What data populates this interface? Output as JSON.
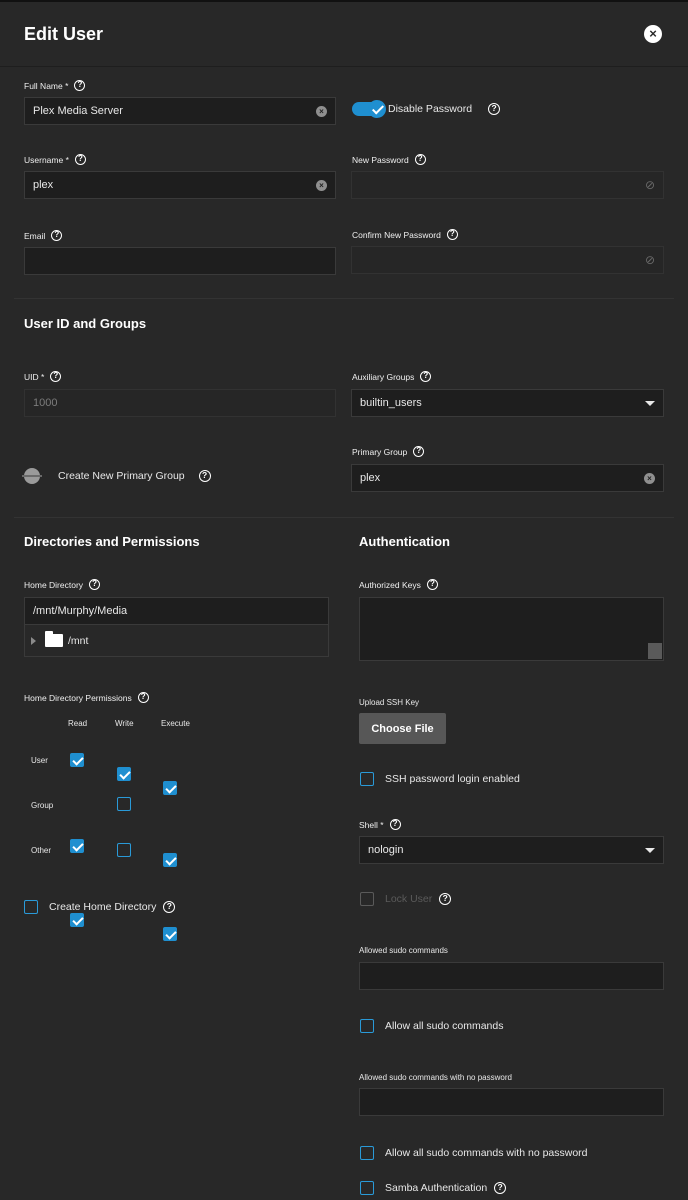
{
  "header": {
    "title": "Edit User",
    "close_icon": "×"
  },
  "identification": {
    "full_name": {
      "label": "Full Name *",
      "value": "Plex Media Server"
    },
    "username": {
      "label": "Username *",
      "value": "plex"
    },
    "email": {
      "label": "Email",
      "value": ""
    },
    "disable_password": {
      "label": "Disable Password",
      "enabled": true
    },
    "new_password": {
      "label": "New Password",
      "value": ""
    },
    "confirm_password": {
      "label": "Confirm New Password",
      "value": ""
    }
  },
  "ids_groups": {
    "section_title": "User ID and Groups",
    "uid": {
      "label": "UID *",
      "value": "1000"
    },
    "aux_groups": {
      "label": "Auxiliary Groups",
      "value": "builtin_users"
    },
    "create_primary": {
      "label": "Create New Primary Group",
      "enabled": false
    },
    "primary_group": {
      "label": "Primary Group",
      "value": "plex"
    }
  },
  "directories": {
    "section_title": "Directories and Permissions",
    "home_dir": {
      "label": "Home Directory",
      "value": "/mnt/Murphy/Media",
      "tree_node": "/mnt"
    },
    "permissions": {
      "label": "Home Directory Permissions",
      "columns": [
        "Read",
        "Write",
        "Execute"
      ],
      "rows": [
        {
          "name": "User",
          "checks": [
            true,
            true,
            true
          ]
        },
        {
          "name": "Group",
          "checks": [
            true,
            false,
            true
          ]
        },
        {
          "name": "Other",
          "checks": [
            true,
            false,
            true
          ]
        }
      ]
    },
    "create_home": {
      "label": "Create Home Directory",
      "checked": false
    }
  },
  "authentication": {
    "section_title": "Authentication",
    "authorized_keys": {
      "label": "Authorized Keys",
      "value": ""
    },
    "upload_ssh": {
      "label": "Upload SSH Key",
      "button": "Choose File"
    },
    "ssh_password_login": {
      "label": "SSH password login enabled",
      "checked": false
    },
    "shell": {
      "label": "Shell *",
      "value": "nologin"
    },
    "lock_user": {
      "label": "Lock User",
      "checked": false,
      "disabled": true
    },
    "sudo_commands": {
      "label": "Allowed sudo commands",
      "value": ""
    },
    "allow_all_sudo": {
      "label": "Allow all sudo commands",
      "checked": false
    },
    "sudo_nopasswd": {
      "label": "Allowed sudo commands with no password",
      "value": ""
    },
    "allow_all_sudo_nopasswd": {
      "label": "Allow all sudo commands with no password",
      "checked": false
    },
    "samba_auth": {
      "label": "Samba Authentication",
      "checked": false
    }
  },
  "colors": {
    "accent": "#1f8fd0",
    "background": "#282828",
    "field": "#1e1e1e"
  },
  "icons": {
    "help": "question-circle",
    "clear": "x-circle",
    "eye": "eye-off",
    "folder": "folder",
    "dropdown": "caret-down"
  }
}
